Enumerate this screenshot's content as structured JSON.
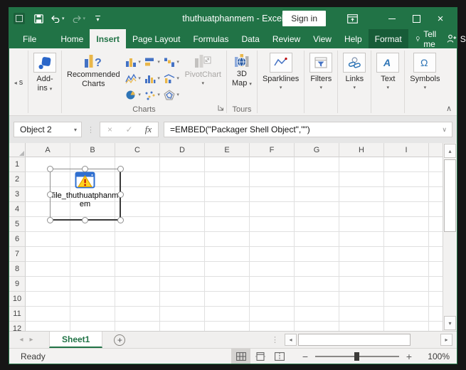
{
  "titlebar": {
    "title": "thuthuatphanmem - Excel",
    "sign_in": "Sign in"
  },
  "ribbon": {
    "tabs": [
      "File",
      "Home",
      "Insert",
      "Page Layout",
      "Formulas",
      "Data",
      "Review",
      "View",
      "Help",
      "Format"
    ],
    "active_tab": "Insert",
    "contextual_tab": "Format",
    "tell_me": "Tell me",
    "share": "Share",
    "truncated_group_label": "s",
    "addins": {
      "line1": "Add-",
      "line2": "ins"
    },
    "charts": {
      "recommended_line1": "Recommended",
      "recommended_line2": "Charts",
      "pivotchart": "PivotChart",
      "group_label": "Charts"
    },
    "tours": {
      "map_line1": "3D",
      "map_line2": "Map",
      "group_label": "Tours"
    },
    "collapsed_buttons": [
      "Sparklines",
      "Filters",
      "Links",
      "Text",
      "Symbols"
    ]
  },
  "formula_bar": {
    "name_box": "Object 2",
    "fx_label": "fx",
    "formula": "=EMBED(\"Packager Shell Object\",\"\")"
  },
  "grid": {
    "columns": [
      "A",
      "B",
      "C",
      "D",
      "E",
      "F",
      "G",
      "H",
      "I"
    ],
    "rows": [
      "1",
      "2",
      "3",
      "4",
      "5",
      "6",
      "7",
      "8",
      "9",
      "10",
      "11",
      "12"
    ],
    "object": {
      "label": "file_thuthuatphanmem"
    }
  },
  "sheet_tabs": {
    "active": "Sheet1"
  },
  "status_bar": {
    "mode": "Ready",
    "zoom_level": "100%"
  },
  "icons": {
    "dropdown": "▾",
    "up_small": "▴",
    "down_small": "▾",
    "left_small": "◂",
    "right_small": "▸",
    "chevron_up": "∧",
    "chevron_down": "∨",
    "dots": "⋮",
    "cancel": "×",
    "check": "✓",
    "close": "×",
    "minus": "−",
    "plus": "+"
  },
  "colors": {
    "excel_green": "#217346",
    "contextual_tab_green": "#175c38",
    "ribbon_bg": "#f3f2f1",
    "icon_blue": "#4472c4",
    "icon_gold": "#e9b74a",
    "warning_yellow": "#ffd21e",
    "warning_red": "#c00000",
    "object_blue": "#2f6fd0"
  }
}
